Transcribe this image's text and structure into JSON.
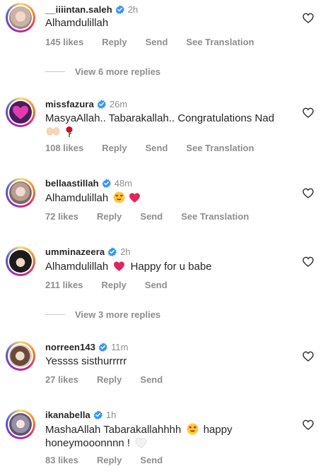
{
  "colors": {
    "verified": "#3897f0",
    "secondary": "#8e8e8e",
    "primary": "#262626"
  },
  "comments": [
    {
      "username": "__iiiintan.saleh",
      "verified": true,
      "time": "2h",
      "text": "Alhamdulillah",
      "likes": "145 likes",
      "actions": [
        "Reply",
        "Send",
        "See Translation"
      ]
    },
    {
      "username": "missfazura",
      "verified": true,
      "time": "26m",
      "text": "MasyaAllah.. Tabarakallah.. Congratulations Nad",
      "text2_emoji": [
        "raising-hands-emoji",
        "rose-emoji"
      ],
      "likes": "108 likes",
      "actions": [
        "Reply",
        "Send",
        "See Translation"
      ]
    },
    {
      "username": "bellaastillah",
      "verified": true,
      "time": "48m",
      "text": "Alhamdulillah",
      "emoji": [
        "heart-eyes-emoji",
        "red-heart-emoji"
      ],
      "likes": "72 likes",
      "actions": [
        "Reply",
        "Send",
        "See Translation"
      ]
    },
    {
      "username": "umminazeera",
      "verified": true,
      "time": "2h",
      "text": "Alhamdulillah",
      "text_after": "Happy for u babe",
      "emoji": [
        "red-heart-emoji"
      ],
      "likes": "211 likes",
      "actions": [
        "Reply",
        "Send"
      ]
    },
    {
      "username": "norreen143",
      "verified": true,
      "time": "11m",
      "text": "Yessss sisthurrrrr",
      "likes": "27 likes",
      "actions": [
        "Reply",
        "Send"
      ]
    },
    {
      "username": "ikanabella",
      "verified": true,
      "time": "1h",
      "text": "MashaAllah Tabarakallahhhh",
      "text_after": "happy",
      "text2": "honeymooonnnn !",
      "emoji": [
        "heart-eyes-emoji",
        "white-heart-emoji"
      ],
      "likes": "83 likes",
      "actions": [
        "Reply",
        "Send"
      ]
    }
  ],
  "view_replies": [
    "View 6 more replies",
    "View 3 more replies"
  ]
}
